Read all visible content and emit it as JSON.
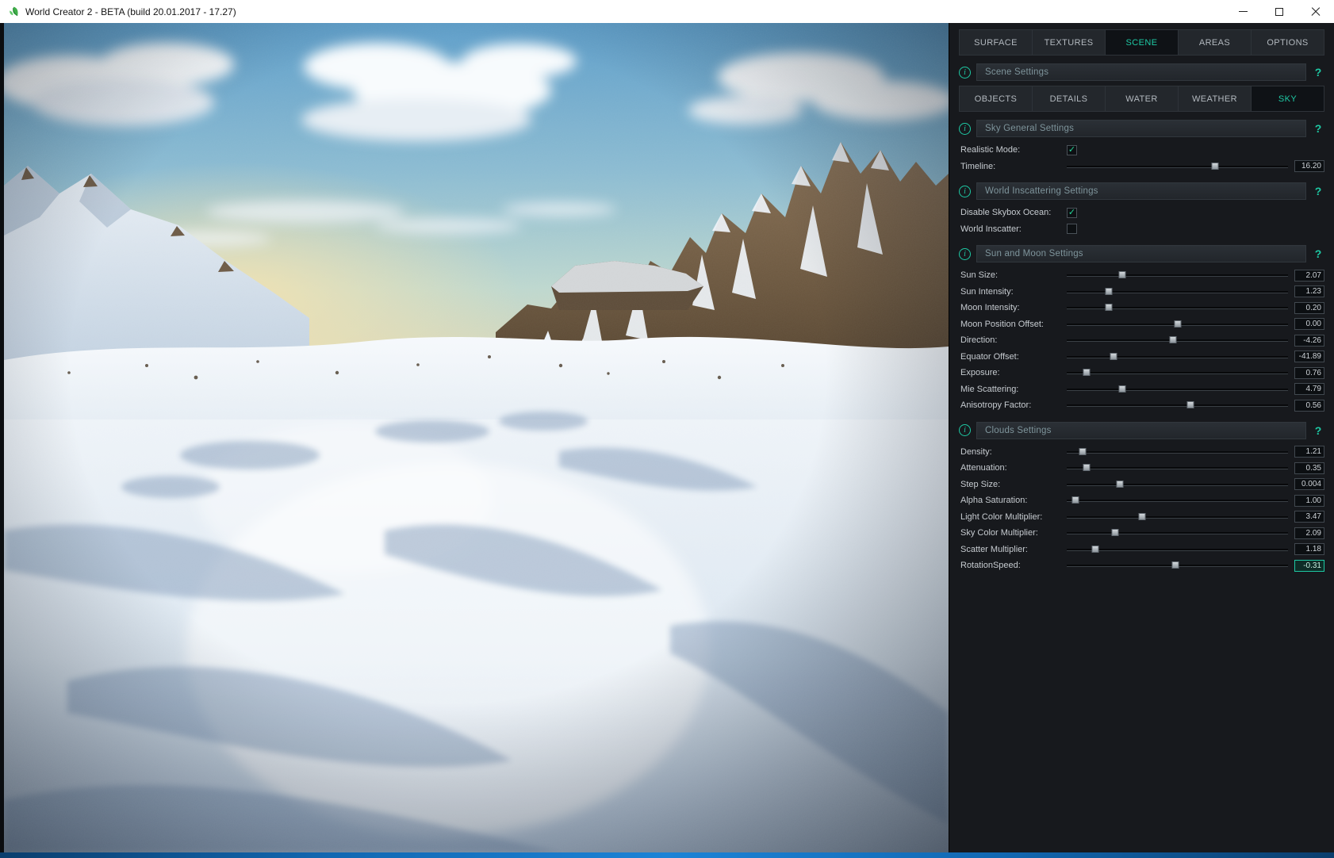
{
  "window": {
    "title": "World Creator 2 - BETA (build 20.01.2017 - 17.27)"
  },
  "accent_color": "#1ec9a4",
  "icons": {
    "info_glyph": "i",
    "help_glyph": "?"
  },
  "main_tabs": [
    "SURFACE",
    "TEXTURES",
    "SCENE",
    "AREAS",
    "OPTIONS"
  ],
  "panel": {
    "scene_settings_title": "Scene Settings",
    "sub_tabs": [
      "OBJECTS",
      "DETAILS",
      "WATER",
      "WEATHER",
      "SKY"
    ],
    "sky_general": {
      "title": "Sky General Settings",
      "realistic_mode": {
        "label": "Realistic Mode:",
        "check": "✓"
      },
      "timeline": {
        "label": "Timeline:",
        "value": "16.20",
        "pos": "67%"
      }
    },
    "world_inscattering": {
      "title": "World Inscattering Settings",
      "disable_skybox_ocean": {
        "label": "Disable Skybox Ocean:",
        "check": "✓"
      },
      "world_inscatter": {
        "label": "World Inscatter:",
        "check": ""
      }
    },
    "sun_moon": {
      "title": "Sun and Moon Settings",
      "rows": [
        {
          "label": "Sun Size:",
          "value": "2.07",
          "pos": "25%"
        },
        {
          "label": "Sun Intensity:",
          "value": "1.23",
          "pos": "19%"
        },
        {
          "label": "Moon Intensity:",
          "value": "0.20",
          "pos": "19%"
        },
        {
          "label": "Moon Position Offset:",
          "value": "0.00",
          "pos": "50%"
        },
        {
          "label": "Direction:",
          "value": "-4.26",
          "pos": "48%"
        },
        {
          "label": "Equator Offset:",
          "value": "-41.89",
          "pos": "21%"
        },
        {
          "label": "Exposure:",
          "value": "0.76",
          "pos": "9%"
        },
        {
          "label": "Mie Scattering:",
          "value": "4.79",
          "pos": "25%"
        },
        {
          "label": "Anisotropy Factor:",
          "value": "0.56",
          "pos": "56%"
        }
      ]
    },
    "clouds": {
      "title": "Clouds Settings",
      "rows": [
        {
          "label": "Density:",
          "value": "1.21",
          "pos": "7%"
        },
        {
          "label": "Attenuation:",
          "value": "0.35",
          "pos": "9%"
        },
        {
          "label": "Step Size:",
          "value": "0.004",
          "pos": "24%"
        },
        {
          "label": "Alpha Saturation:",
          "value": "1.00",
          "pos": "4%"
        },
        {
          "label": "Light Color Multiplier:",
          "value": "3.47",
          "pos": "34%"
        },
        {
          "label": "Sky Color Multiplier:",
          "value": "2.09",
          "pos": "22%"
        },
        {
          "label": "Scatter Multiplier:",
          "value": "1.18",
          "pos": "13%"
        },
        {
          "label": "RotationSpeed:",
          "value": "-0.31",
          "pos": "49%"
        }
      ]
    }
  }
}
